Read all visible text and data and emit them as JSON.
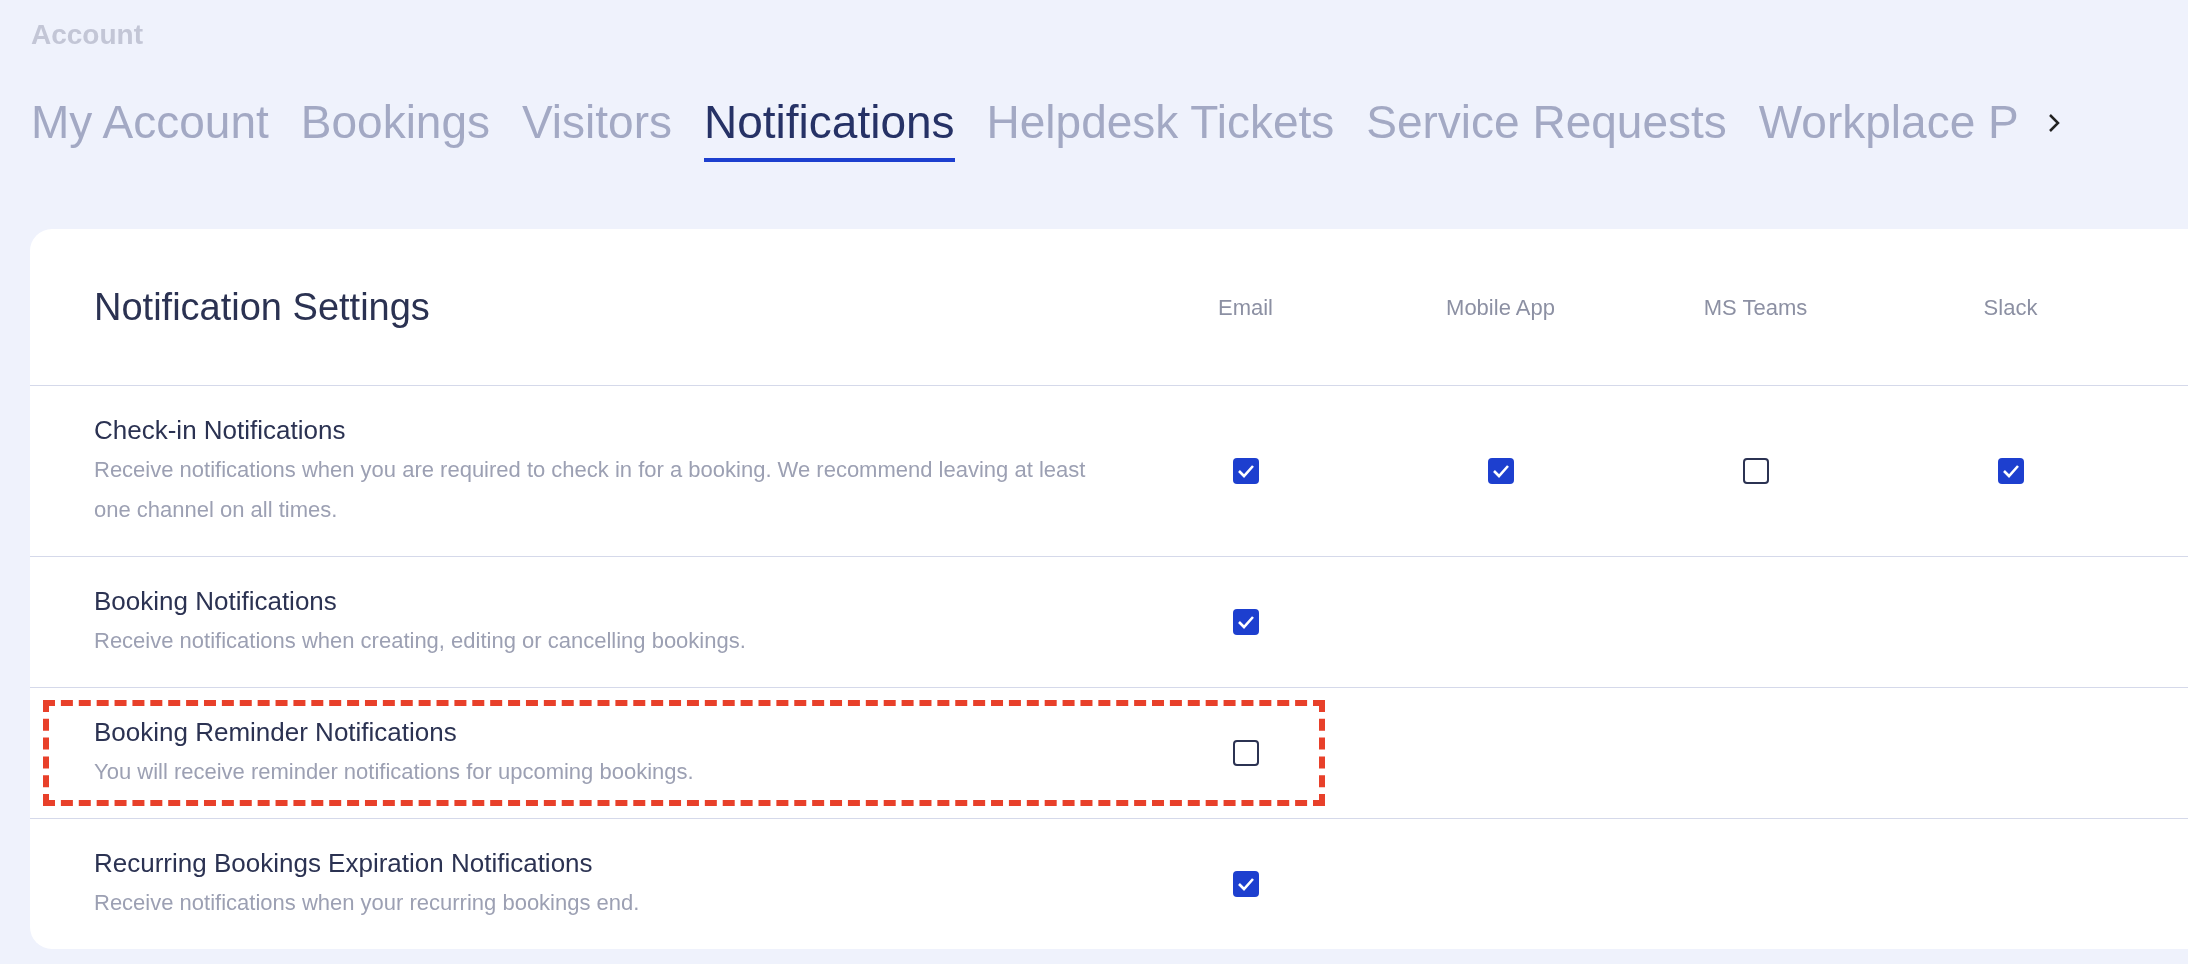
{
  "section_label": "Account",
  "tabs": [
    {
      "label": "My Account",
      "selected": false
    },
    {
      "label": "Bookings",
      "selected": false
    },
    {
      "label": "Visitors",
      "selected": false
    },
    {
      "label": "Notifications",
      "selected": true
    },
    {
      "label": "Helpdesk Tickets",
      "selected": false
    },
    {
      "label": "Service Requests",
      "selected": false
    },
    {
      "label": "Workplace P",
      "selected": false
    }
  ],
  "settings": {
    "title": "Notification Settings",
    "columns": [
      "Email",
      "Mobile App",
      "MS Teams",
      "Slack"
    ],
    "rows": [
      {
        "title": "Check-in Notifications",
        "description": "Receive notifications when you are required to check in for a booking. We recommend leaving at least one channel on all times.",
        "highlighted": false,
        "checkboxes": [
          {
            "checked": true
          },
          {
            "checked": true
          },
          {
            "checked": false
          },
          {
            "checked": true
          }
        ]
      },
      {
        "title": "Booking Notifications",
        "description": "Receive notifications when creating, editing or cancelling bookings.",
        "highlighted": false,
        "checkboxes": [
          {
            "checked": true
          }
        ]
      },
      {
        "title": "Booking Reminder Notifications",
        "description": "You will receive reminder notifications for upcoming bookings.",
        "highlighted": true,
        "checkboxes": [
          {
            "checked": false
          }
        ]
      },
      {
        "title": "Recurring Bookings Expiration Notifications",
        "description": "Receive notifications when your recurring bookings end.",
        "highlighted": false,
        "checkboxes": [
          {
            "checked": true
          }
        ]
      }
    ]
  }
}
